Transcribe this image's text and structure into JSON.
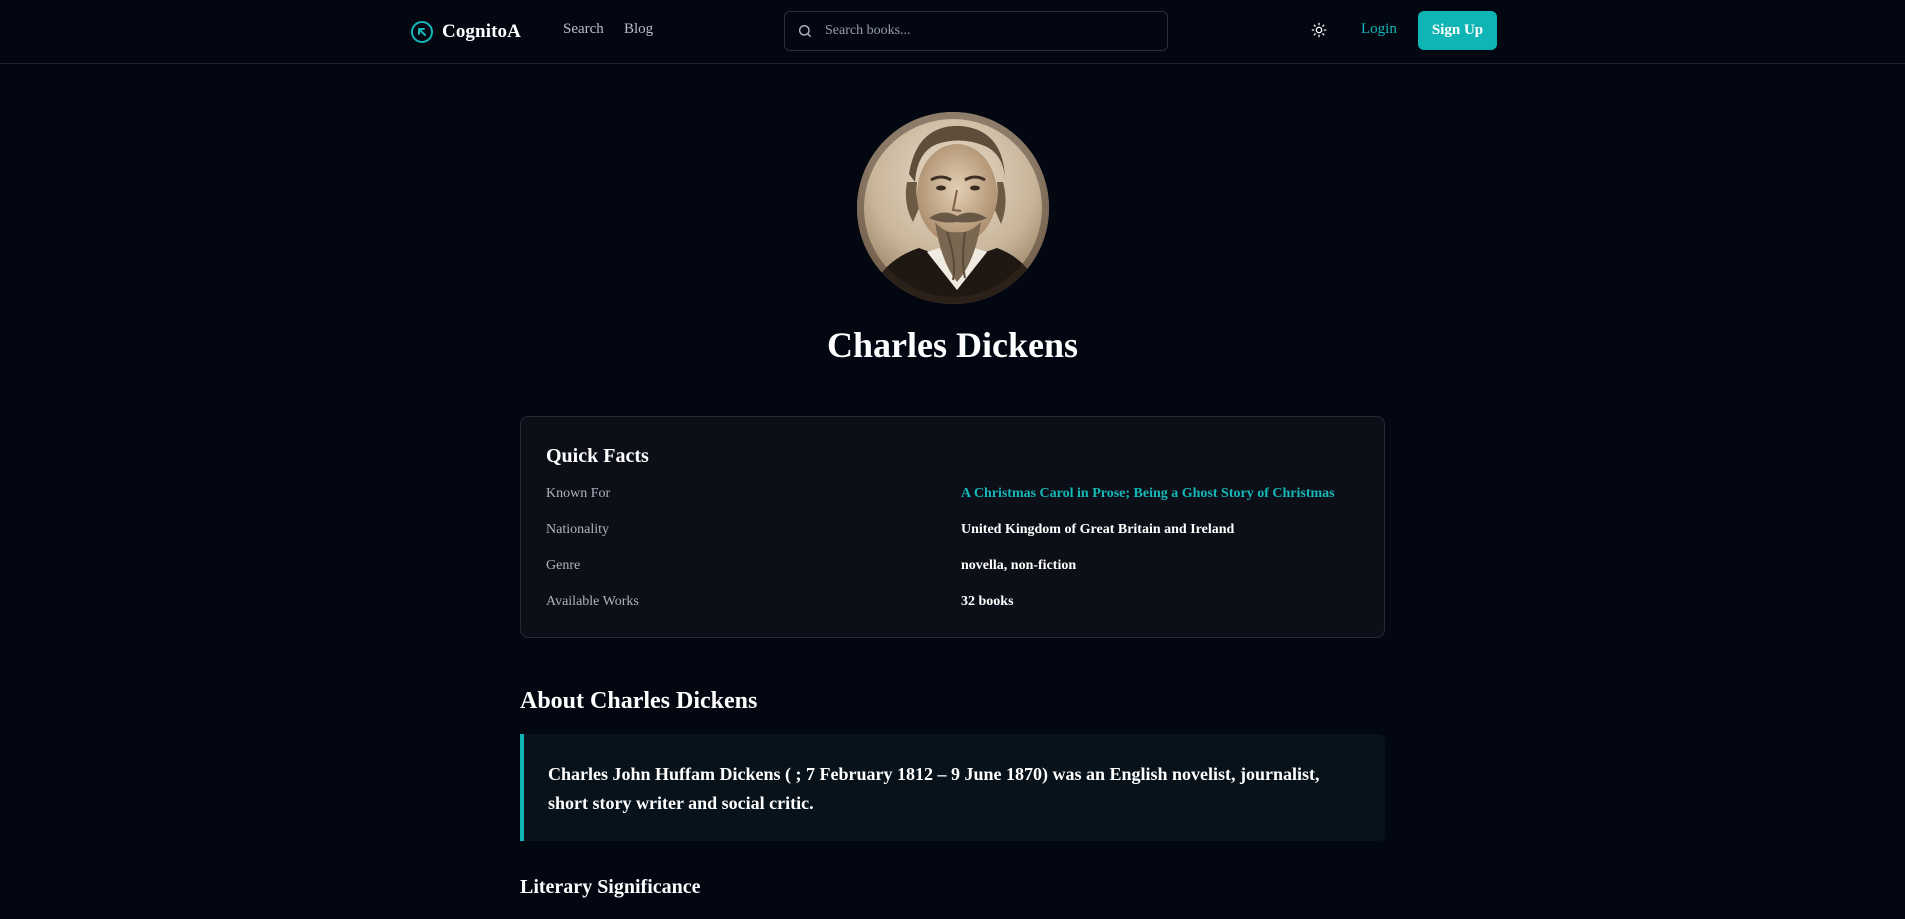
{
  "header": {
    "brand_name": "CognitoA",
    "brand_icon": "arrow-up-left-circle-icon",
    "nav": [
      {
        "label": "Search"
      },
      {
        "label": "Blog"
      }
    ],
    "search_placeholder": "Search books...",
    "theme_icon": "sun-icon",
    "login_label": "Login",
    "signup_label": "Sign Up"
  },
  "author": {
    "name": "Charles Dickens"
  },
  "quick_facts": {
    "title": "Quick Facts",
    "rows": [
      {
        "label": "Known For",
        "value": "A Christmas Carol in Prose; Being a Ghost Story of Christmas"
      },
      {
        "label": "Nationality",
        "value": "United Kingdom of Great Britain and Ireland"
      },
      {
        "label": "Genre",
        "value": "novella, non-fiction"
      },
      {
        "label": "Available Works",
        "value": "32 books"
      }
    ]
  },
  "about": {
    "heading": "About Charles Dickens",
    "quote": "Charles John Huffam Dickens ( ; 7 February 1812 – 9 June 1870) was an English novelist, journalist, short story writer and social critic."
  },
  "literary_significance": {
    "heading": "Literary Significance"
  },
  "colors": {
    "background": "#030712",
    "accent": "#0fb5b5",
    "card": "#0d0f18",
    "border": "#262a35"
  }
}
